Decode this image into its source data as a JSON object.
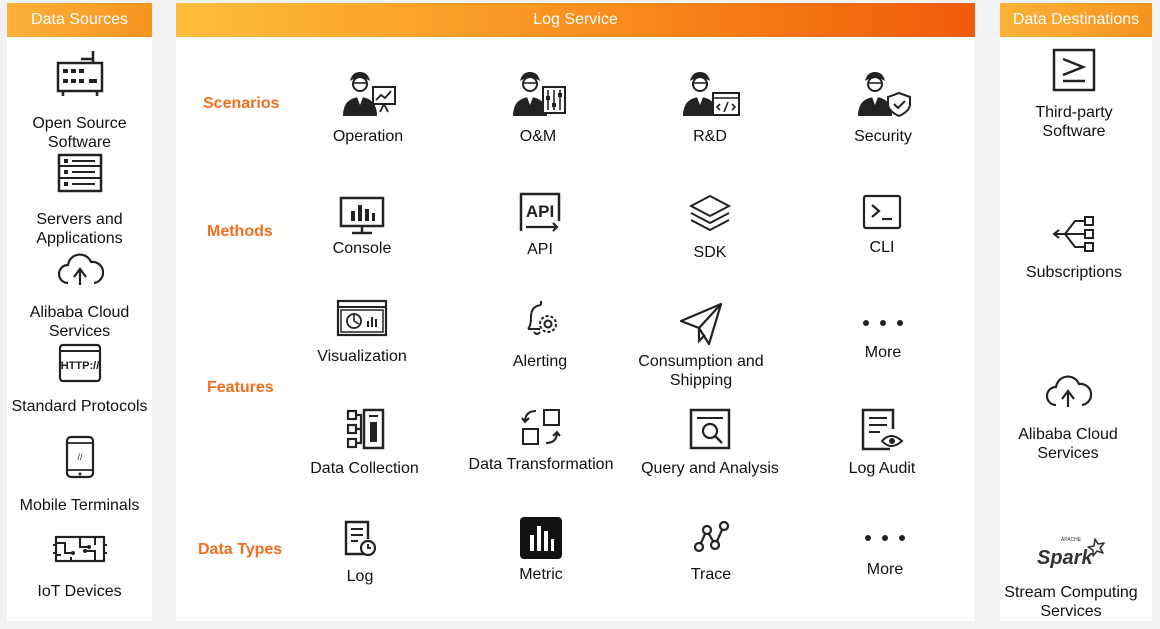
{
  "sources": {
    "title": "Data Sources",
    "items": [
      {
        "label": "Open Source\nSoftware",
        "icon": "router-icon"
      },
      {
        "label": "Servers and\nApplications",
        "icon": "server-list-icon"
      },
      {
        "label": "Alibaba Cloud\nServices",
        "icon": "cloud-upload-icon"
      },
      {
        "label": "Standard Protocols",
        "icon": "http-icon"
      },
      {
        "label": "Mobile Terminals",
        "icon": "mobile-phone-icon"
      },
      {
        "label": "IoT Devices",
        "icon": "circuit-board-icon"
      }
    ]
  },
  "service": {
    "title": "Log Service",
    "categories": {
      "scenarios": "Scenarios",
      "methods": "Methods",
      "features": "Features",
      "data_types": "Data Types"
    },
    "scenarios": [
      {
        "label": "Operation",
        "icon": "person-presentation-icon"
      },
      {
        "label": "O&M",
        "icon": "person-sliders-icon"
      },
      {
        "label": "R&D",
        "icon": "person-code-icon"
      },
      {
        "label": "Security",
        "icon": "person-shield-icon"
      }
    ],
    "methods": [
      {
        "label": "Console",
        "icon": "monitor-chart-icon"
      },
      {
        "label": "API",
        "icon": "api-icon"
      },
      {
        "label": "SDK",
        "icon": "layers-icon"
      },
      {
        "label": "CLI",
        "icon": "terminal-icon"
      }
    ],
    "features_row1": [
      {
        "label": "Visualization",
        "icon": "dashboard-window-icon"
      },
      {
        "label": "Alerting",
        "icon": "bell-gear-icon"
      },
      {
        "label": "Consumption and\nShipping",
        "icon": "paper-plane-icon"
      },
      {
        "label": "More",
        "icon": "more-dots-icon"
      }
    ],
    "features_row2": [
      {
        "label": "Data Collection",
        "icon": "collection-icon"
      },
      {
        "label": "Data Transformation",
        "icon": "transform-icon"
      },
      {
        "label": "Query  and Analysis",
        "icon": "query-search-icon"
      },
      {
        "label": "Log Audit",
        "icon": "log-audit-icon"
      }
    ],
    "data_types": [
      {
        "label": "Log",
        "icon": "log-doc-icon"
      },
      {
        "label": "Metric",
        "icon": "metric-bars-icon"
      },
      {
        "label": "Trace",
        "icon": "trace-icon"
      },
      {
        "label": "More",
        "icon": "more-dots-icon"
      }
    ]
  },
  "destinations": {
    "title": "Data Destinations",
    "items": [
      {
        "label": "Third-party\nSoftware",
        "icon": "third-party-icon"
      },
      {
        "label": "Subscriptions",
        "icon": "subscription-tree-icon"
      },
      {
        "label": "Alibaba Cloud\nServices",
        "icon": "cloud-upload-icon"
      },
      {
        "label": "Stream Computing\nServices",
        "icon": "spark-logo-icon"
      }
    ],
    "spark_small": "APACHE",
    "spark_word": "Spark"
  }
}
